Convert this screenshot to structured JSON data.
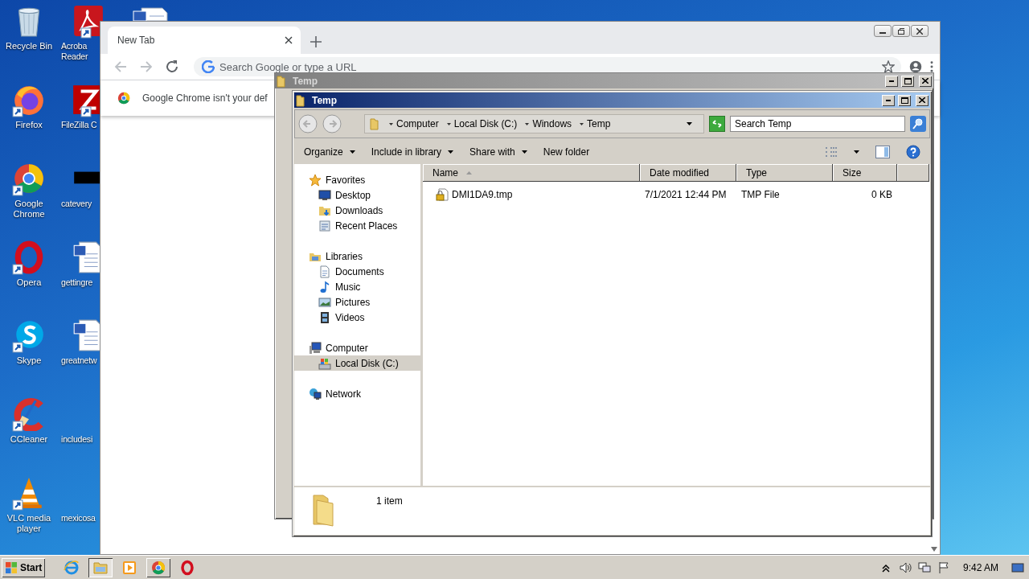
{
  "desktop": {
    "icon_columns": [
      {
        "icons": [
          {
            "label": "Recycle Bin",
            "kind": "recycle-bin",
            "shortcut": false
          },
          {
            "label": "Firefox",
            "kind": "firefox",
            "shortcut": true
          },
          {
            "label": "Google Chrome",
            "kind": "chrome",
            "shortcut": true
          },
          {
            "label": "Opera",
            "kind": "opera",
            "shortcut": true
          },
          {
            "label": "Skype",
            "kind": "skype",
            "shortcut": true
          },
          {
            "label": "CCleaner",
            "kind": "ccleaner",
            "shortcut": true
          },
          {
            "label": "VLC media player",
            "kind": "vlc",
            "shortcut": true
          }
        ]
      },
      {
        "icons": [
          {
            "label": "Acroba Reader",
            "kind": "pdf",
            "shortcut": true
          },
          {
            "label": "FileZilla C",
            "kind": "filezilla",
            "shortcut": true
          },
          {
            "label": "catevery",
            "kind": "image",
            "shortcut": false
          },
          {
            "label": "gettingre",
            "kind": "word",
            "shortcut": false
          },
          {
            "label": "greatnetw",
            "kind": "word",
            "shortcut": false
          },
          {
            "label": "includesi",
            "kind": "blank",
            "shortcut": false
          },
          {
            "label": "mexicosa",
            "kind": "blank",
            "shortcut": false
          }
        ]
      }
    ],
    "partial_icon": {
      "kind": "word"
    }
  },
  "chrome": {
    "tab": {
      "title": "New Tab"
    },
    "omnibox": {
      "placeholder": "Search Google or type a URL"
    },
    "infobar": {
      "message": "Google Chrome isn't your def"
    }
  },
  "back_window": {
    "title": "Temp"
  },
  "explorer": {
    "title": "Temp",
    "breadcrumb": [
      "Computer",
      "Local Disk (C:)",
      "Windows",
      "Temp"
    ],
    "search": {
      "placeholder": "Search Temp"
    },
    "commands": [
      {
        "label": "Organize",
        "menu": true
      },
      {
        "label": "Include in library",
        "menu": true
      },
      {
        "label": "Share with",
        "menu": true
      },
      {
        "label": "New folder",
        "menu": false
      }
    ],
    "nav": [
      {
        "label": "Favorites",
        "kind": "favorites",
        "selected": false,
        "children": [
          {
            "label": "Desktop",
            "kind": "desktop",
            "selected": false
          },
          {
            "label": "Downloads",
            "kind": "downloads",
            "selected": false
          },
          {
            "label": "Recent Places",
            "kind": "recent",
            "selected": false
          }
        ]
      },
      {
        "label": "Libraries",
        "kind": "libraries",
        "selected": false,
        "children": [
          {
            "label": "Documents",
            "kind": "documents",
            "selected": false
          },
          {
            "label": "Music",
            "kind": "music",
            "selected": false
          },
          {
            "label": "Pictures",
            "kind": "pictures",
            "selected": false
          },
          {
            "label": "Videos",
            "kind": "videos",
            "selected": false
          }
        ]
      },
      {
        "label": "Computer",
        "kind": "computer",
        "selected": false,
        "children": [
          {
            "label": "Local Disk (C:)",
            "kind": "disk",
            "selected": true
          }
        ]
      },
      {
        "label": "Network",
        "kind": "network",
        "selected": false
      }
    ],
    "columns": [
      {
        "label": "Name",
        "sorted": true
      },
      {
        "label": "Date modified",
        "sorted": false
      },
      {
        "label": "Type",
        "sorted": false
      },
      {
        "label": "Size",
        "sorted": false
      }
    ],
    "rows": [
      {
        "cells": [
          "DMI1DA9.tmp",
          "7/1/2021 12:44 PM",
          "TMP File",
          "0 KB"
        ]
      }
    ],
    "status": "1 item"
  },
  "taskbar": {
    "start": "Start",
    "apps": [
      {
        "kind": "ie",
        "open": false,
        "active": false
      },
      {
        "kind": "explorer",
        "open": true,
        "active": true
      },
      {
        "kind": "media",
        "open": false,
        "active": false
      },
      {
        "kind": "chrome",
        "open": true,
        "active": false
      },
      {
        "kind": "opera",
        "open": false,
        "active": false
      }
    ],
    "time": "9:42 AM"
  }
}
